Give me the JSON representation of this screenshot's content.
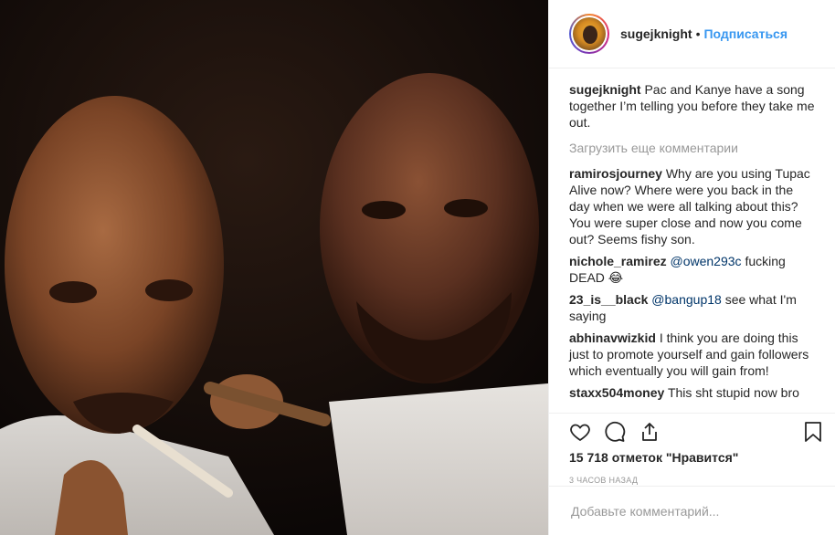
{
  "post": {
    "image_alt": "",
    "author": "sugejknight",
    "follow_label": "Подписаться",
    "caption": {
      "user": "sugejknight",
      "text": "Pac and Kanye have a song together I’m telling you before they take me out."
    },
    "load_more_label": "Загрузить еще комментарии",
    "comments": [
      {
        "user": "ramirosjourney",
        "mention": "",
        "text": "Why are you using Tupac Alive now? Where were you back in the day when we were all talking about this? You were super close and now you come out? Seems fishy son."
      },
      {
        "user": "nichole_ramirez",
        "mention": "@owen293c",
        "text": "fucking DEAD 😂"
      },
      {
        "user": "23_is__black",
        "mention": "@bangup18",
        "text": "see what I'm saying"
      },
      {
        "user": "abhinavwizkid",
        "mention": "",
        "text": "I think you are doing this just to promote yourself and gain followers which eventually you will gain from!"
      },
      {
        "user": "staxx504money",
        "mention": "",
        "text": "This sht stupid now bro"
      }
    ],
    "likes_text": "15 718 отметок \"Нравится\"",
    "timestamp": "3 ЧАСОВ НАЗАД",
    "add_comment_placeholder": "Добавьте комментарий..."
  },
  "icons": {
    "like": "heart-icon",
    "comment": "comment-bubble-icon",
    "share": "share-icon",
    "save": "bookmark-icon"
  },
  "colors": {
    "link": "#3897f0",
    "mention": "#003569",
    "muted": "#999999",
    "text": "#262626"
  }
}
